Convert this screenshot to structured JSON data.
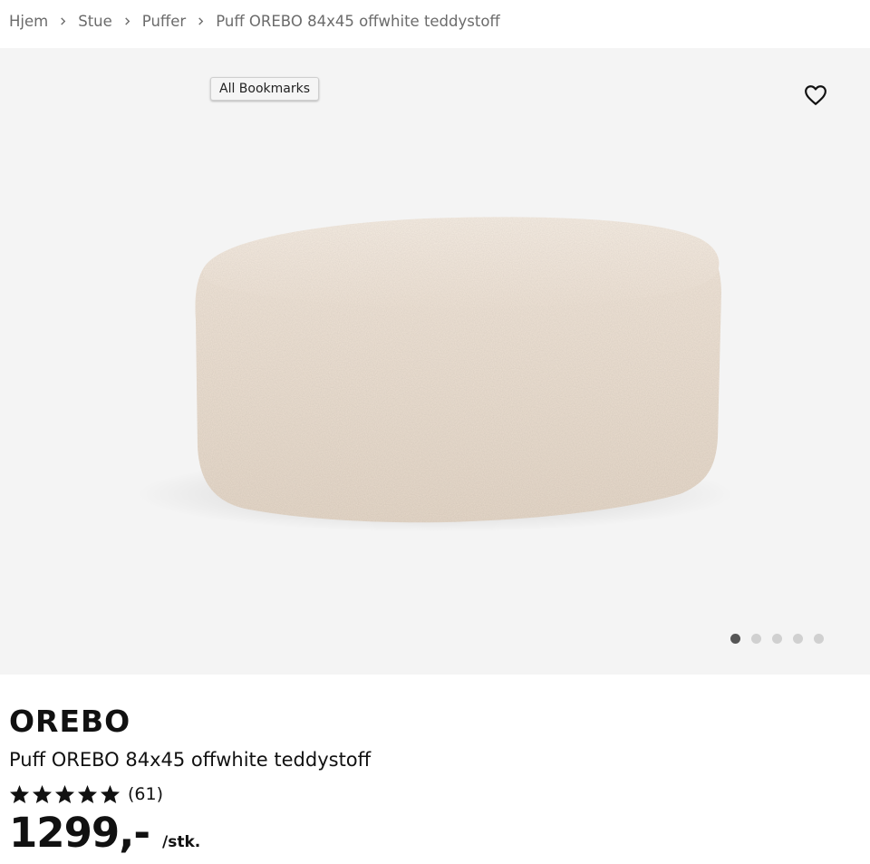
{
  "breadcrumb": {
    "items": [
      {
        "label": "Hjem"
      },
      {
        "label": "Stue"
      },
      {
        "label": "Puffer"
      }
    ],
    "current": "Puff OREBO 84x45 offwhite teddystoff"
  },
  "gallery": {
    "bookmarks_label": "All Bookmarks",
    "favorite_icon": "heart-outline-icon",
    "image_description_icon": "product-image",
    "dots_total": 5,
    "dots_active_index": 0
  },
  "product": {
    "brand": "OREBO",
    "name": "Puff OREBO 84x45 offwhite teddystoff",
    "rating": {
      "stars": 5,
      "count_text": "(61)"
    },
    "price": "1299,-",
    "unit": "/stk."
  },
  "colors": {
    "gallery_bg": "#f4f4f4",
    "fabric": "#efe3d6",
    "dot_active": "#555555",
    "dot_inactive": "#d0d0d0",
    "text": "#111111",
    "breadcrumb_text": "#6b6b6b"
  }
}
